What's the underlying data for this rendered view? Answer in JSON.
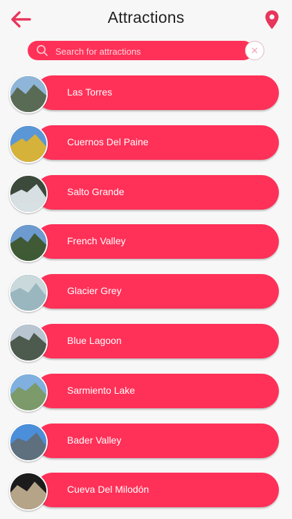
{
  "header": {
    "title": "Attractions",
    "back_icon": "back-arrow-icon",
    "location_icon": "map-pin-icon",
    "accent": "#e8355b"
  },
  "search": {
    "placeholder": "Search for attractions",
    "value": "",
    "clear_icon": "close-icon"
  },
  "attractions": [
    {
      "name": "Las Torres",
      "sky": "#8fb6d8",
      "land": "#5a6b55"
    },
    {
      "name": "Cuernos Del Paine",
      "sky": "#5b97d6",
      "land": "#d5b23a"
    },
    {
      "name": "Salto Grande",
      "sky": "#3c4a3b",
      "land": "#d7dfe3"
    },
    {
      "name": "French Valley",
      "sky": "#6d9bd0",
      "land": "#3f5a35"
    },
    {
      "name": "Glacier Grey",
      "sky": "#c9d9dc",
      "land": "#9ab6be"
    },
    {
      "name": "Blue Lagoon",
      "sky": "#b9c6d2",
      "land": "#4d5a4e"
    },
    {
      "name": "Sarmiento Lake",
      "sky": "#7fb0df",
      "land": "#7c9a6a"
    },
    {
      "name": "Bader Valley",
      "sky": "#4b8fda",
      "land": "#5e6f7e"
    },
    {
      "name": "Cueva Del Milodón",
      "sky": "#1c1c1c",
      "land": "#b5a488"
    }
  ],
  "colors": {
    "pill": "#ff3158",
    "background": "#f7f7f7"
  }
}
